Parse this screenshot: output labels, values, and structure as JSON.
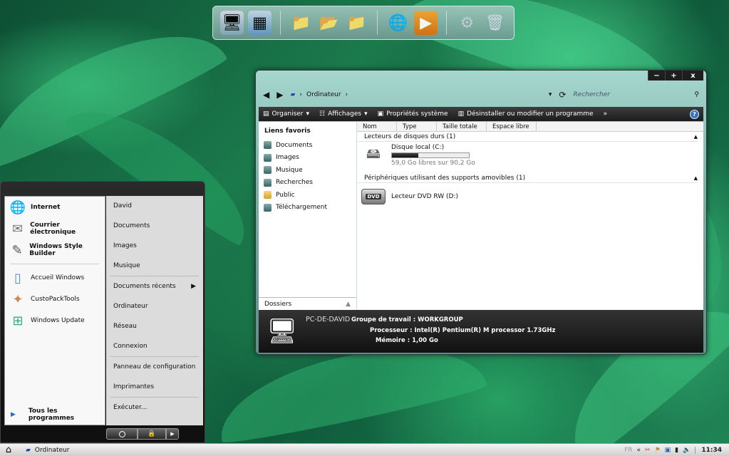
{
  "dock": {
    "icons": [
      "computer-icon",
      "network-icon",
      "documents-folder-icon",
      "pictures-folder-icon",
      "music-folder-icon",
      "internet-globe-icon",
      "media-player-icon",
      "settings-gears-icon",
      "recycle-bin-icon"
    ]
  },
  "explorer": {
    "controls": {
      "minimize": "−",
      "maximize": "+",
      "close": "x"
    },
    "breadcrumb": "Ordinateur",
    "search_placeholder": "Rechercher",
    "toolbar": {
      "organize": "Organiser",
      "views": "Affichages",
      "system_properties": "Propriétés système",
      "uninstall": "Désinstaller ou modifier un programme",
      "more": "»",
      "help": "?"
    },
    "favorites_header": "Liens favoris",
    "favorites": [
      "Documents",
      "Images",
      "Musique",
      "Recherches",
      "Public",
      "Téléchargement"
    ],
    "folders_label": "Dossiers",
    "columns": [
      "Nom",
      "Type",
      "Taille totale",
      "Espace libre"
    ],
    "groups": [
      {
        "label": "Lecteurs de disques durs (1)"
      },
      {
        "label": "Périphériques utilisant des supports amovibles (1)"
      }
    ],
    "local_disk": {
      "name": "Disque local (C:)",
      "info": "59,0 Go libres sur 90,2 Go",
      "used_fraction": 0.346
    },
    "dvd_drive": {
      "name": "Lecteur DVD RW (D:)",
      "badge": "DVD"
    },
    "details": {
      "pc_name": "PC-DE-DAVID",
      "workgroup": "Groupe de travail : WORKGROUP",
      "processor": "Processeur : Intel(R) Pentium(R) M processor 1.73GHz",
      "memory": "Mémoire : 1,00 Go"
    }
  },
  "start_menu": {
    "pinned": [
      {
        "label": "Internet",
        "icon": "internet-globe-icon"
      },
      {
        "label": "Courrier électronique",
        "icon": "mail-icon"
      },
      {
        "label": "Windows Style Builder",
        "icon": "style-builder-icon"
      }
    ],
    "recent": [
      {
        "label": "Accueil Windows",
        "icon": "windows-welcome-icon"
      },
      {
        "label": "CustoPackTools",
        "icon": "custopack-icon"
      },
      {
        "label": "Windows Update",
        "icon": "windows-update-icon"
      }
    ],
    "all_programs": "Tous les programmes",
    "right": [
      "David",
      "Documents",
      "Images",
      "Musique",
      "Documents récents",
      "Ordinateur",
      "Réseau",
      "Connexion",
      "Panneau de configuration",
      "Imprimantes",
      "Exécuter..."
    ]
  },
  "taskbar": {
    "task": "Ordinateur",
    "lang": "FR",
    "time": "11:34"
  },
  "colors": {
    "accent": "#3a6fc7",
    "chrome_dark": "#1c1c1c",
    "glass": "#7cb2a8"
  }
}
